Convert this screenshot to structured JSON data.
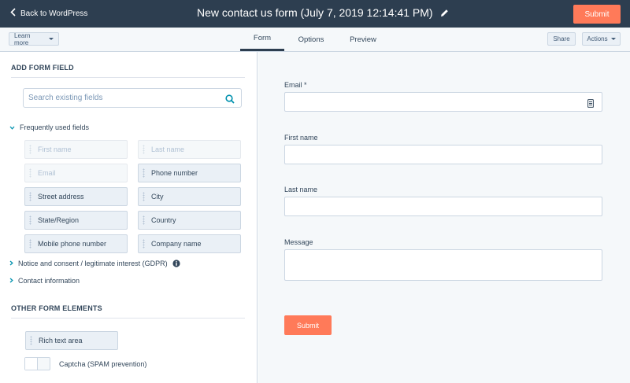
{
  "header": {
    "back_label": "Back to WordPress",
    "title": "New contact us form (July 7, 2019 12:14:41 PM)",
    "submit_label": "Submit"
  },
  "toolbar": {
    "learn_more_label": "Learn more",
    "tabs": [
      {
        "label": "Form",
        "active": true
      },
      {
        "label": "Options",
        "active": false
      },
      {
        "label": "Preview",
        "active": false
      }
    ],
    "share_label": "Share",
    "actions_label": "Actions"
  },
  "sidebar": {
    "add_field_heading": "ADD FORM FIELD",
    "search_placeholder": "Search existing fields",
    "frequent_group_label": "Frequently used fields",
    "fields": [
      {
        "label": "First name",
        "enabled": false
      },
      {
        "label": "Last name",
        "enabled": false
      },
      {
        "label": "Email",
        "enabled": false
      },
      {
        "label": "Phone number",
        "enabled": true
      },
      {
        "label": "Street address",
        "enabled": true
      },
      {
        "label": "City",
        "enabled": true
      },
      {
        "label": "State/Region",
        "enabled": true
      },
      {
        "label": "Country",
        "enabled": true
      },
      {
        "label": "Mobile phone number",
        "enabled": true
      },
      {
        "label": "Company name",
        "enabled": true
      }
    ],
    "gdpr_group_label": "Notice and consent / legitimate interest (GDPR)",
    "contact_group_label": "Contact information",
    "other_heading": "OTHER FORM ELEMENTS",
    "rich_text_label": "Rich text area",
    "captcha_label": "Captcha (SPAM prevention)",
    "captcha_enabled": false
  },
  "preview": {
    "fields": [
      {
        "label": "Email *"
      },
      {
        "label": "First name"
      },
      {
        "label": "Last name"
      },
      {
        "label": "Message"
      }
    ],
    "submit_label": "Submit"
  },
  "colors": {
    "header_bg": "#2d3e50",
    "accent": "#ff7a59",
    "field_bg": "#eaf0f6",
    "border": "#cbd6e2"
  }
}
